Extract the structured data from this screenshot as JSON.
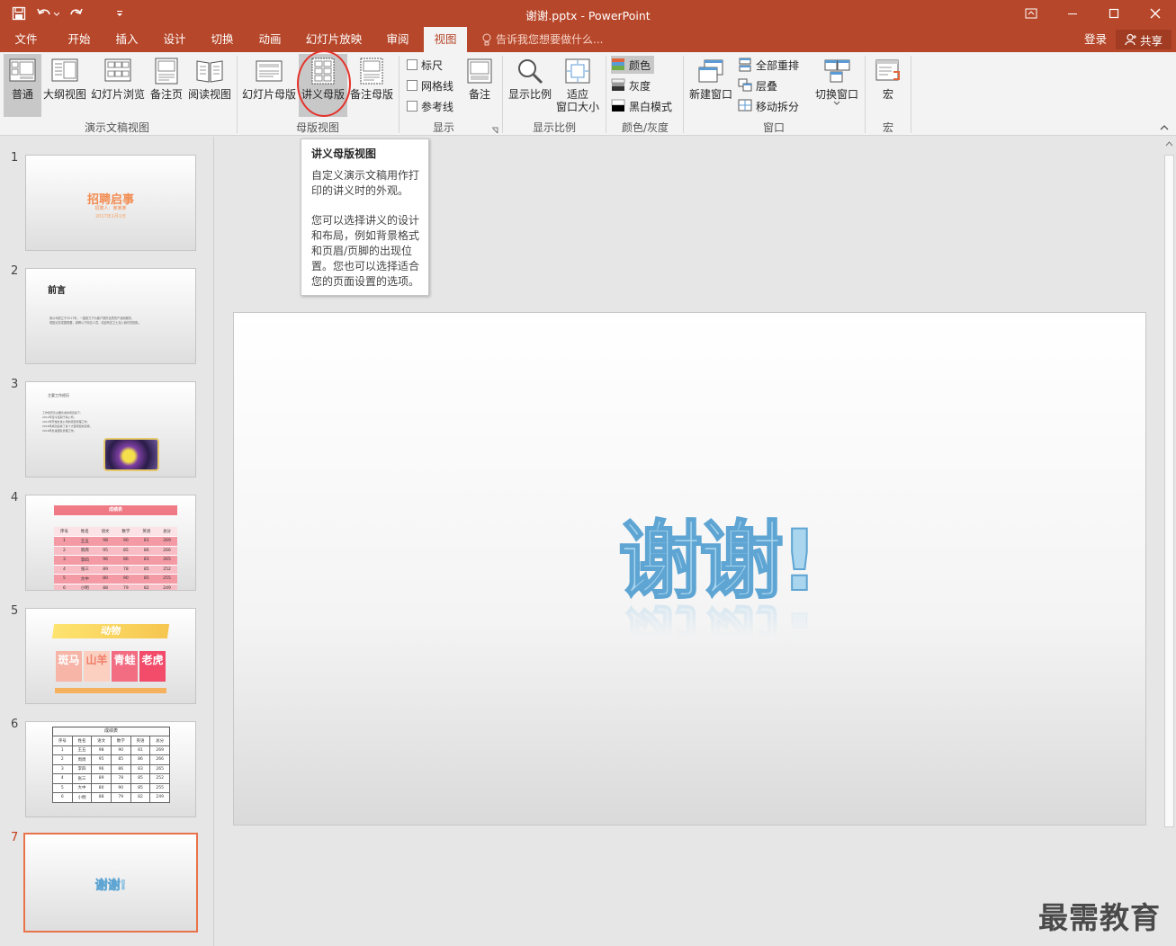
{
  "window": {
    "title": "谢谢.pptx - PowerPoint"
  },
  "tabs": [
    {
      "label": "文件",
      "active": false
    },
    {
      "label": "开始",
      "active": false
    },
    {
      "label": "插入",
      "active": false
    },
    {
      "label": "设计",
      "active": false
    },
    {
      "label": "切换",
      "active": false
    },
    {
      "label": "动画",
      "active": false
    },
    {
      "label": "幻灯片放映",
      "active": false
    },
    {
      "label": "审阅",
      "active": false
    },
    {
      "label": "视图",
      "active": true
    }
  ],
  "tell_me": "告诉我您想要做什么...",
  "account": {
    "login": "登录",
    "share": "共享"
  },
  "ribbon": {
    "presentation_views": {
      "group_label": "演示文稿视图",
      "buttons": [
        "普通",
        "大纲视图",
        "幻灯片浏览",
        "备注页",
        "阅读视图"
      ],
      "selected": "普通"
    },
    "master_views": {
      "group_label": "母版视图",
      "buttons": [
        "幻灯片母版",
        "讲义母版",
        "备注母版"
      ],
      "highlighted": "讲义母版"
    },
    "show": {
      "group_label": "显示",
      "checkboxes": [
        {
          "label": "标尺",
          "checked": false
        },
        {
          "label": "网格线",
          "checked": false
        },
        {
          "label": "参考线",
          "checked": false
        }
      ],
      "notes_button": "备注"
    },
    "zoom": {
      "group_label": "显示比例",
      "zoom_button": "显示比例",
      "fit_line1": "适应",
      "fit_line2": "窗口大小"
    },
    "color": {
      "group_label": "颜色/灰度",
      "options": [
        "颜色",
        "灰度",
        "黑白模式"
      ],
      "selected": "颜色"
    },
    "window": {
      "group_label": "窗口",
      "new_window": "新建窗口",
      "arrange_all": "全部重排",
      "cascade": "层叠",
      "move_split": "移动拆分",
      "switch_windows": "切换窗口"
    },
    "macros": {
      "group_label": "宏",
      "button": "宏"
    }
  },
  "tooltip": {
    "title": "讲义母版视图",
    "para1": "自定义演示文稿用作打印的讲义时的外观。",
    "para2": "您可以选择讲义的设计和布局，例如背景格式和页眉/页脚的出现位置。您也可以选择适合您的页面设置的选项。"
  },
  "slides": [
    {
      "number": "1",
      "title": "招聘启事",
      "sub": "招聘人：某某某",
      "date": "2017年1月1日"
    },
    {
      "number": "2",
      "title": "前言",
      "lines": [
        "我公司成立于2017年，一直致力于为客户提供优质的产品和服务，",
        "现因业务发展需要，诚聘以下岗位人员，欢迎有志之士加入我们的团队。"
      ]
    },
    {
      "number": "3",
      "title": "主要工作经历",
      "lines": [
        "工作经历及主要负责的项目如下：",
        "2012年至今任职于某公司，",
        "2014年开始负责公司的项目管理工作，",
        "2016年成功完成了多个大型项目的实施，",
        "2016年负责团队管理工作。"
      ]
    },
    {
      "number": "4",
      "title": "成绩表"
    },
    {
      "number": "5",
      "title": "动物",
      "cells": [
        "斑马",
        "山羊",
        "青蛙",
        "老虎"
      ]
    },
    {
      "number": "6",
      "title": "成绩表"
    },
    {
      "number": "7",
      "title": "谢谢!"
    }
  ],
  "score_table": {
    "headers": [
      "序号",
      "姓名",
      "语文",
      "数学",
      "英语",
      "总分"
    ],
    "rows": [
      [
        "1",
        "王五",
        "98",
        "90",
        "81",
        "269"
      ],
      [
        "2",
        "周周",
        "95",
        "85",
        "86",
        "266"
      ],
      [
        "3",
        "李四",
        "96",
        "86",
        "83",
        "265"
      ],
      [
        "4",
        "张三",
        "89",
        "78",
        "85",
        "252"
      ],
      [
        "5",
        "大中",
        "80",
        "90",
        "85",
        "255"
      ],
      [
        "6",
        "小明",
        "88",
        "79",
        "82",
        "249"
      ]
    ]
  },
  "main_slide": {
    "text": "谢谢!"
  },
  "watermark": "最需教育",
  "colors": {
    "accent": "#b7472a",
    "selected_bg": "#c8c8c8",
    "slide_text_fill": "#a9d5ee",
    "slide_text_stroke": "#5fa5d3",
    "thumb_active_border": "#e8734a",
    "annotation_circle": "#e4322b"
  }
}
